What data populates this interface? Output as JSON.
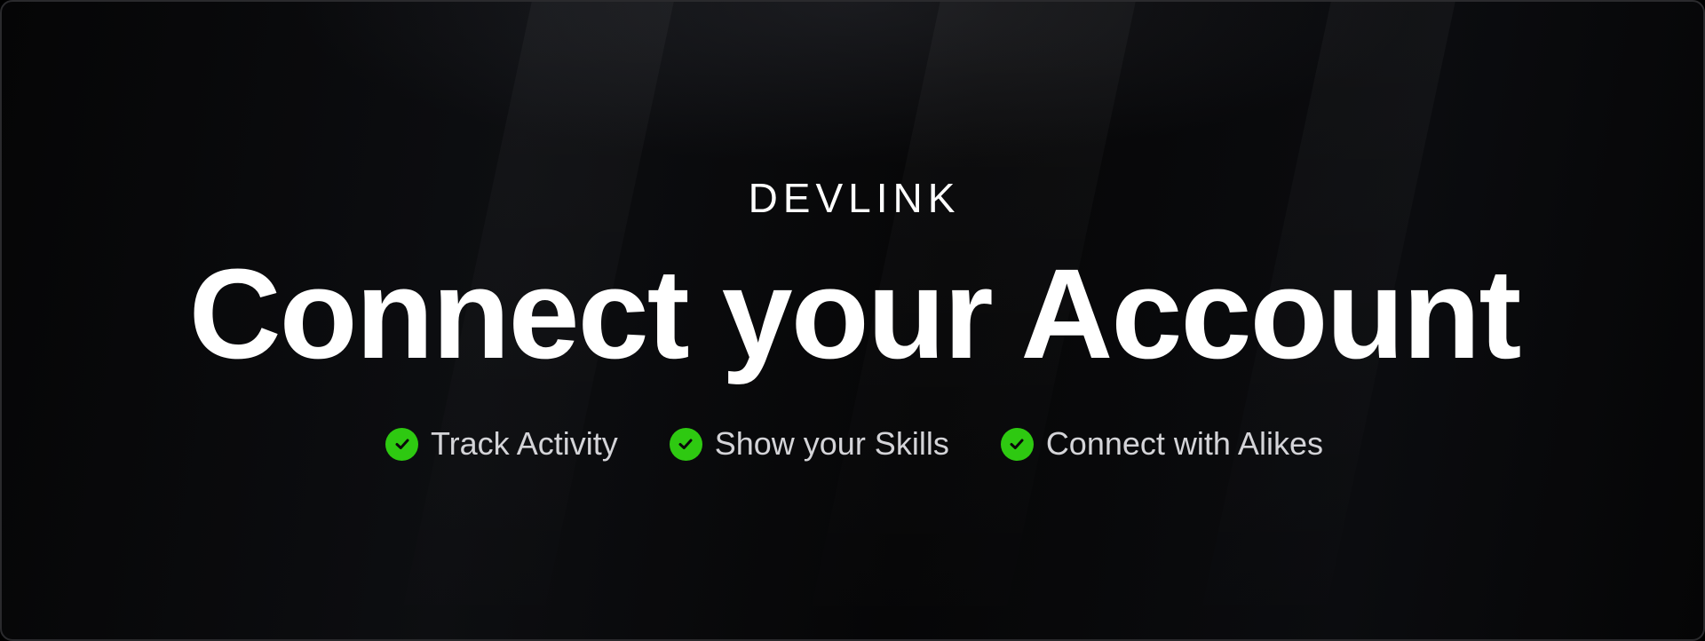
{
  "brand": {
    "logo_text": "DEVLINK"
  },
  "hero": {
    "title": "Connect your Account"
  },
  "features": [
    {
      "label": "Track Activity",
      "icon": "check-circle-icon"
    },
    {
      "label": "Show your Skills",
      "icon": "check-circle-icon"
    },
    {
      "label": "Connect with Alikes",
      "icon": "check-circle-icon"
    }
  ],
  "colors": {
    "background": "#000000",
    "title": "#ffffff",
    "feature_text": "#d4d4d8",
    "check_accent": "#2ec911"
  }
}
